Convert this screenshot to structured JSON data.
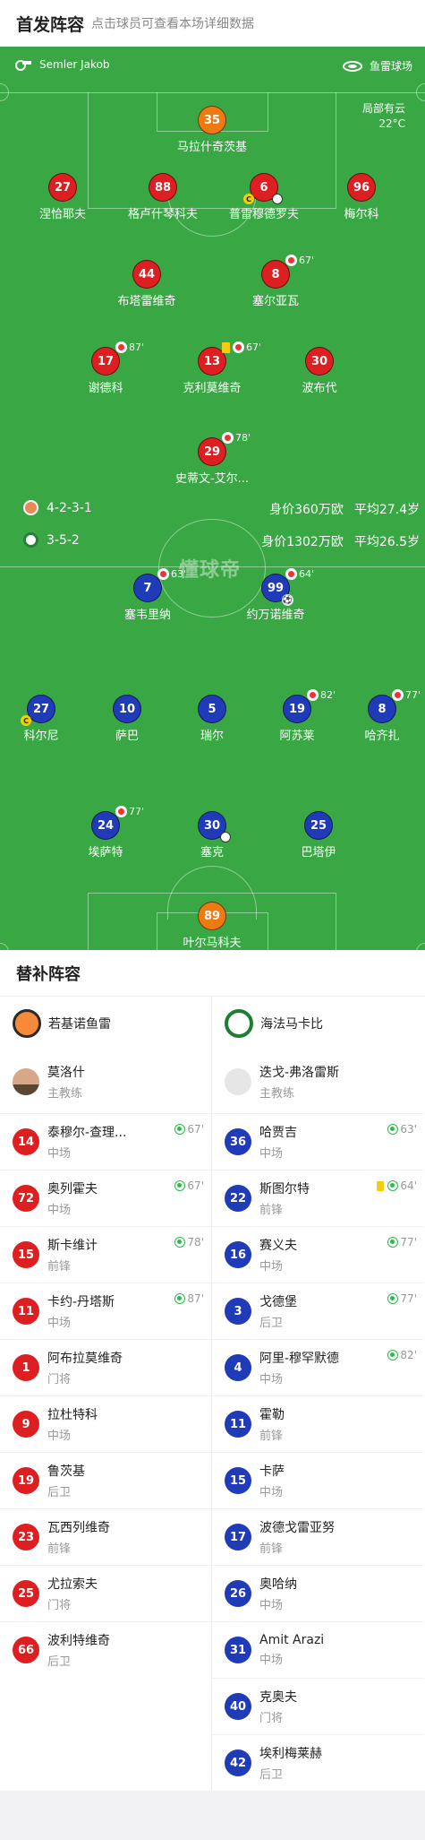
{
  "header": {
    "title": "首发阵容",
    "subtitle": "点击球员可查看本场详细数据"
  },
  "pitch": {
    "referee": "Semler Jakob",
    "venue": "鱼雷球场",
    "weather": "局部有云",
    "temperature": "22°C",
    "watermark": "懂球帝"
  },
  "home": {
    "team_name": "若基诺鱼雷",
    "formation": "4-2-3-1",
    "value_text": "身价360万欧",
    "age_text": "平均27.4岁",
    "coach": {
      "name": "莫洛什",
      "role": "主教练"
    },
    "lineup": [
      {
        "num": "35",
        "name": "马拉什奇茨基",
        "color": "o"
      },
      {
        "num": "27",
        "name": "涅恰耶夫",
        "color": "r"
      },
      {
        "num": "88",
        "name": "格卢什琴科夫",
        "color": "r"
      },
      {
        "num": "6",
        "name": "普雷穆德罗夫",
        "color": "r",
        "captain": "C"
      },
      {
        "num": "96",
        "name": "梅尔科",
        "color": "r"
      },
      {
        "num": "44",
        "name": "布塔雷维奇",
        "color": "r"
      },
      {
        "num": "8",
        "name": "塞尔亚瓦",
        "color": "r",
        "sub": "67'"
      },
      {
        "num": "17",
        "name": "谢德科",
        "color": "r",
        "sub": "87'"
      },
      {
        "num": "13",
        "name": "克利莫维奇",
        "color": "r",
        "sub": "67'",
        "yellow": true
      },
      {
        "num": "30",
        "name": "波布代",
        "color": "r"
      },
      {
        "num": "29",
        "name": "史蒂文-艾尔...",
        "color": "r",
        "sub": "78'"
      }
    ],
    "bench": [
      {
        "num": "14",
        "name": "泰穆尔-查理...",
        "pos": "中场",
        "time": "67'"
      },
      {
        "num": "72",
        "name": "奥列霍夫",
        "pos": "中场",
        "time": "67'"
      },
      {
        "num": "15",
        "name": "斯卡维计",
        "pos": "前锋",
        "time": "78'"
      },
      {
        "num": "11",
        "name": "卡约-丹塔斯",
        "pos": "中场",
        "time": "87'"
      },
      {
        "num": "1",
        "name": "阿布拉莫维奇",
        "pos": "门将"
      },
      {
        "num": "9",
        "name": "拉杜特科",
        "pos": "中场"
      },
      {
        "num": "19",
        "name": "鲁茨基",
        "pos": "后卫"
      },
      {
        "num": "23",
        "name": "瓦西列维奇",
        "pos": "前锋"
      },
      {
        "num": "25",
        "name": "尤拉索夫",
        "pos": "门将"
      },
      {
        "num": "66",
        "name": "波利特维奇",
        "pos": "后卫"
      }
    ]
  },
  "away": {
    "team_name": "海法马卡比",
    "formation": "3-5-2",
    "value_text": "身价1302万欧",
    "age_text": "平均26.5岁",
    "coach": {
      "name": "迭戈-弗洛雷斯",
      "role": "主教练"
    },
    "lineup": [
      {
        "num": "7",
        "name": "塞韦里纳",
        "color": "b",
        "sub": "63'"
      },
      {
        "num": "99",
        "name": "约万诺维奇",
        "color": "b",
        "sub": "64'"
      },
      {
        "num": "27",
        "name": "科尔尼",
        "color": "b",
        "captain": "C"
      },
      {
        "num": "10",
        "name": "萨巴",
        "color": "b"
      },
      {
        "num": "5",
        "name": "瑞尔",
        "color": "b"
      },
      {
        "num": "19",
        "name": "阿苏莱",
        "color": "b",
        "sub": "82'"
      },
      {
        "num": "8",
        "name": "哈齐扎",
        "color": "b",
        "sub": "77'"
      },
      {
        "num": "24",
        "name": "埃萨特",
        "color": "b",
        "sub": "77'"
      },
      {
        "num": "30",
        "name": "塞克",
        "color": "b"
      },
      {
        "num": "25",
        "name": "巴塔伊",
        "color": "b"
      },
      {
        "num": "89",
        "name": "叶尔马科夫",
        "color": "o"
      }
    ],
    "bench": [
      {
        "num": "36",
        "name": "哈贾吉",
        "pos": "中场",
        "time": "63'"
      },
      {
        "num": "22",
        "name": "斯图尔特",
        "pos": "前锋",
        "time": "64'",
        "yellow": true
      },
      {
        "num": "16",
        "name": "赛义夫",
        "pos": "中场",
        "time": "77'"
      },
      {
        "num": "3",
        "name": "戈德堡",
        "pos": "后卫",
        "time": "77'"
      },
      {
        "num": "4",
        "name": "阿里-穆罕默德",
        "pos": "中场",
        "time": "82'"
      },
      {
        "num": "11",
        "name": "霍勒",
        "pos": "前锋"
      },
      {
        "num": "15",
        "name": "卡萨",
        "pos": "中场"
      },
      {
        "num": "17",
        "name": "波德戈雷亚努",
        "pos": "前锋"
      },
      {
        "num": "26",
        "name": "奥哈纳",
        "pos": "中场"
      },
      {
        "num": "31",
        "name": "Amit Arazi",
        "pos": "中场"
      },
      {
        "num": "40",
        "name": "克奥夫",
        "pos": "门将"
      },
      {
        "num": "42",
        "name": "埃利梅莱赫",
        "pos": "后卫"
      }
    ]
  },
  "bench_title": "替补阵容",
  "colors": {
    "pitch": "#39a844",
    "home": "#dd1f21",
    "away": "#1f3bb8",
    "keeper": "#f07a12",
    "sub_in": "#2dba4e"
  }
}
